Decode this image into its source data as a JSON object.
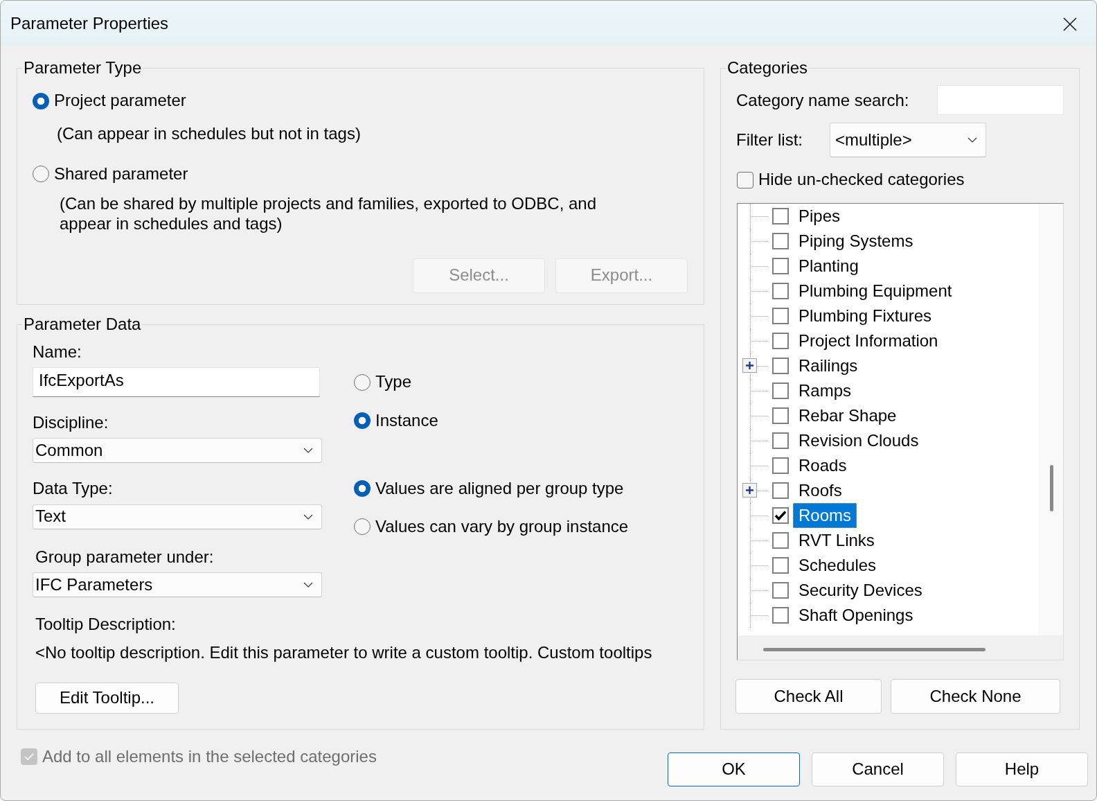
{
  "window": {
    "title": "Parameter Properties"
  },
  "parameter_type": {
    "title": "Parameter Type",
    "options": [
      {
        "label": "Project parameter",
        "description": "(Can appear in schedules but not in tags)",
        "selected": true
      },
      {
        "label": "Shared parameter",
        "description": "(Can be shared by multiple projects and families, exported to ODBC, and appear in schedules and tags)",
        "selected": false
      }
    ],
    "buttons": [
      {
        "label": "Select...",
        "disabled": true
      },
      {
        "label": "Export...",
        "disabled": true
      }
    ]
  },
  "parameter_data": {
    "title": "Parameter Data",
    "name": {
      "label": "Name:",
      "value": "IfcExportAs"
    },
    "discipline": {
      "label": "Discipline:",
      "value": "Common"
    },
    "data_type": {
      "label": "Data Type:",
      "value": "Text"
    },
    "group_under": {
      "label": "Group parameter under:",
      "value": "IFC Parameters"
    },
    "scope_options": [
      {
        "label": "Type",
        "selected": false
      },
      {
        "label": "Instance",
        "selected": true
      }
    ],
    "group_options": [
      {
        "label": "Values are aligned per group type",
        "selected": true
      },
      {
        "label": "Values can vary by group instance",
        "selected": false
      }
    ],
    "tooltip": {
      "label": "Tooltip Description:",
      "text": "<No tooltip description. Edit this parameter to write a custom tooltip. Custom tooltips"
    },
    "edit_tooltip_button": "Edit Tooltip..."
  },
  "categories": {
    "title": "Categories",
    "search": {
      "label": "Category name search:"
    },
    "filter": {
      "label": "Filter list:",
      "value": "<multiple>"
    },
    "hide_unchecked": {
      "label": "Hide un-checked categories",
      "checked": false
    },
    "items": [
      {
        "label": "Pipes",
        "kind": "leaf",
        "checked": false,
        "selected": false
      },
      {
        "label": "Piping Systems",
        "kind": "leaf",
        "checked": false,
        "selected": false
      },
      {
        "label": "Planting",
        "kind": "leaf",
        "checked": false,
        "selected": false
      },
      {
        "label": "Plumbing Equipment",
        "kind": "leaf",
        "checked": false,
        "selected": false
      },
      {
        "label": "Plumbing Fixtures",
        "kind": "leaf",
        "checked": false,
        "selected": false
      },
      {
        "label": "Project Information",
        "kind": "leaf",
        "checked": false,
        "selected": false
      },
      {
        "label": "Railings",
        "kind": "group",
        "checked": false,
        "selected": false
      },
      {
        "label": "Ramps",
        "kind": "leaf",
        "checked": false,
        "selected": false
      },
      {
        "label": "Rebar Shape",
        "kind": "leaf",
        "checked": false,
        "selected": false
      },
      {
        "label": "Revision Clouds",
        "kind": "leaf",
        "checked": false,
        "selected": false
      },
      {
        "label": "Roads",
        "kind": "leaf",
        "checked": false,
        "selected": false
      },
      {
        "label": "Roofs",
        "kind": "group",
        "checked": false,
        "selected": false
      },
      {
        "label": "Rooms",
        "kind": "leaf",
        "checked": true,
        "selected": true
      },
      {
        "label": "RVT Links",
        "kind": "leaf",
        "checked": false,
        "selected": false
      },
      {
        "label": "Schedules",
        "kind": "leaf",
        "checked": false,
        "selected": false
      },
      {
        "label": "Security Devices",
        "kind": "leaf",
        "checked": false,
        "selected": false
      },
      {
        "label": "Shaft Openings",
        "kind": "leaf",
        "checked": false,
        "selected": false
      }
    ],
    "buttons": [
      "Check All",
      "Check None"
    ]
  },
  "add_to_all": {
    "label": "Add to all elements in the selected categories",
    "checked": true,
    "disabled": true
  },
  "buttons": [
    {
      "label": "OK",
      "default": true
    },
    {
      "label": "Cancel",
      "default": false
    },
    {
      "label": "Help",
      "default": false
    }
  ]
}
